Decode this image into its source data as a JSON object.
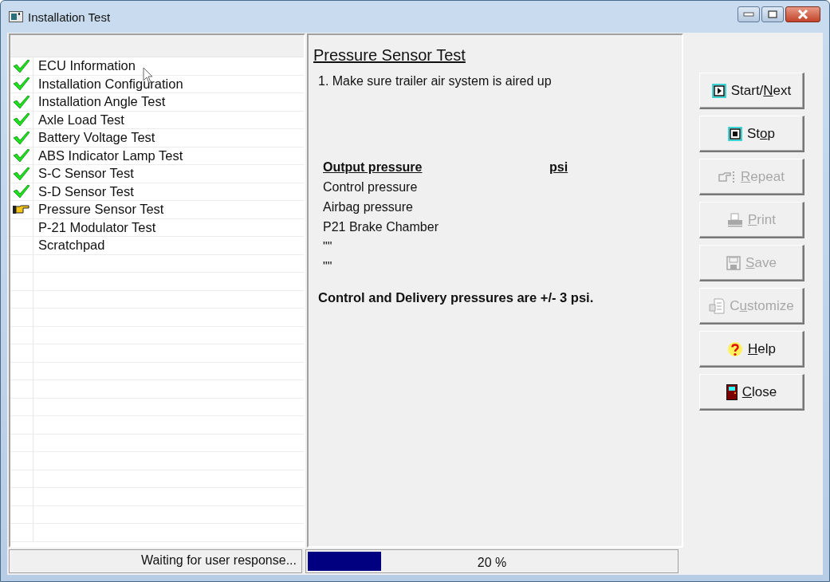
{
  "window": {
    "title": "Installation Test"
  },
  "tests": [
    {
      "label": "ECU Information",
      "kind": "done"
    },
    {
      "label": "Installation Configuration",
      "kind": "done"
    },
    {
      "label": "Installation Angle Test",
      "kind": "done"
    },
    {
      "label": "Axle Load Test",
      "kind": "done"
    },
    {
      "label": "Battery Voltage Test",
      "kind": "done"
    },
    {
      "label": "ABS Indicator Lamp Test",
      "kind": "done"
    },
    {
      "label": "S-C Sensor Test",
      "kind": "done"
    },
    {
      "label": "S-D Sensor Test",
      "kind": "done"
    },
    {
      "label": "Pressure Sensor Test",
      "kind": "current"
    },
    {
      "label": "P-21 Modulator Test",
      "kind": "pending"
    },
    {
      "label": "Scratchpad",
      "kind": "pending"
    }
  ],
  "content": {
    "heading": "Pressure Sensor Test",
    "instruction": "1. Make sure trailer air system is aired up",
    "table_header": [
      "Output pressure",
      "psi"
    ],
    "rows": [
      "Control pressure",
      "Airbag pressure",
      "P21 Brake Chamber",
      "\"\"",
      "\"\""
    ],
    "note": "Control and Delivery pressures are +/- 3 psi."
  },
  "buttons": [
    {
      "label_start": "Start/",
      "accel_key": "N",
      "label_end": "ext",
      "kind": "play",
      "disabled": false
    },
    {
      "label_start": "St",
      "accel_key": "o",
      "label_end": "p",
      "kind": "stop",
      "disabled": false
    },
    {
      "accel_key": "R",
      "label_end": "epeat",
      "kind": "hand",
      "disabled": true
    },
    {
      "accel_key": "P",
      "label_end": "rint",
      "kind": "printer",
      "disabled": true
    },
    {
      "accel_key": "S",
      "label_end": "ave",
      "kind": "disk",
      "disabled": true
    },
    {
      "label_start": "C",
      "accel_key": "u",
      "label_end": "stomize",
      "kind": "document",
      "disabled": true
    },
    {
      "accel_key": "H",
      "label_end": "elp",
      "kind": "question",
      "disabled": false
    },
    {
      "accel_key": "C",
      "label_end": "lose",
      "kind": "door",
      "disabled": false
    }
  ],
  "status_bar": {
    "message": "Waiting for user response...",
    "progress": {
      "level": 0.2,
      "reading": "20 %"
    }
  }
}
